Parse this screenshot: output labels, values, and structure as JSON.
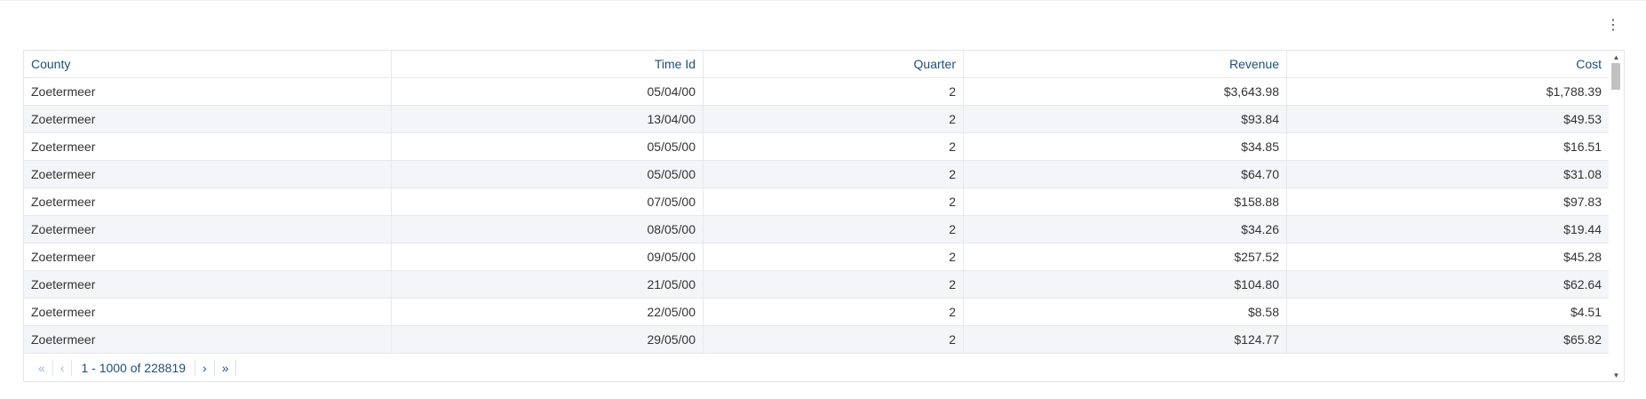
{
  "menu_icon": "vertical-ellipsis-icon",
  "table": {
    "columns": [
      "County",
      "Time Id",
      "Quarter",
      "Revenue",
      "Cost"
    ],
    "rows": [
      [
        "Zoetermeer",
        "05/04/00",
        "2",
        "$3,643.98",
        "$1,788.39"
      ],
      [
        "Zoetermeer",
        "13/04/00",
        "2",
        "$93.84",
        "$49.53"
      ],
      [
        "Zoetermeer",
        "05/05/00",
        "2",
        "$34.85",
        "$16.51"
      ],
      [
        "Zoetermeer",
        "05/05/00",
        "2",
        "$64.70",
        "$31.08"
      ],
      [
        "Zoetermeer",
        "07/05/00",
        "2",
        "$158.88",
        "$97.83"
      ],
      [
        "Zoetermeer",
        "08/05/00",
        "2",
        "$34.26",
        "$19.44"
      ],
      [
        "Zoetermeer",
        "09/05/00",
        "2",
        "$257.52",
        "$45.28"
      ],
      [
        "Zoetermeer",
        "21/05/00",
        "2",
        "$104.80",
        "$62.64"
      ],
      [
        "Zoetermeer",
        "22/05/00",
        "2",
        "$8.58",
        "$4.51"
      ],
      [
        "Zoetermeer",
        "29/05/00",
        "2",
        "$124.77",
        "$65.82"
      ]
    ]
  },
  "pagination": {
    "first_label": "«",
    "prev_label": "‹",
    "info": "1 - 1000 of 228819",
    "next_label": "›",
    "last_label": "»"
  },
  "colors": {
    "header_text": "#1f4f7a",
    "stripe": "#f4f5f8",
    "pager_disabled": "#9db4cf"
  }
}
